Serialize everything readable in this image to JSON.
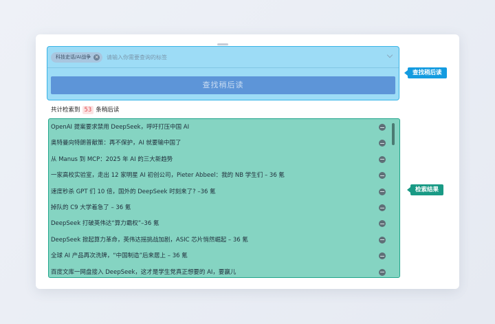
{
  "search": {
    "tag_label": "科技史话/AI战争",
    "placeholder": "请输入你需要查询的标签",
    "find_button": "查找稍后读"
  },
  "annotations": {
    "search": "查找稍后读",
    "results": "检索结果"
  },
  "count": {
    "prefix": "共计检索到",
    "number": "53",
    "suffix": "条稍后读"
  },
  "results": [
    "OpenAI 提案要求禁用 DeepSeek，呼吁打压中国 AI",
    "奥特曼向特朗普献策：再不保护，AI 就要输中国了",
    "从 Manus 到 MCP：2025 年 AI 的三大新趋势",
    "一家高校实验室，走出 12 家明星 AI 初创公司，Pieter Abbeel：我的 NB 学生们 – 36 氪",
    "速度秒杀 GPT 们 10 倍，国外的 DeepSeek 时刻来了? –36 氪",
    "掉队的 C9 大学着急了 – 36 氪",
    "DeepSeek 打破英伟达“算力霸权”–36 氪",
    "DeepSeek 掀起算力革命，英伟达摇挑战加剧，ASIC 芯片悄然崛起 – 36 氪",
    "全球 AI 产品再次洗牌，“中国制造”后来居上 – 36 氪",
    "百度文库一网盘接入 DeepSeek，这才是学生党真正想要的 AI，要赢儿"
  ]
}
